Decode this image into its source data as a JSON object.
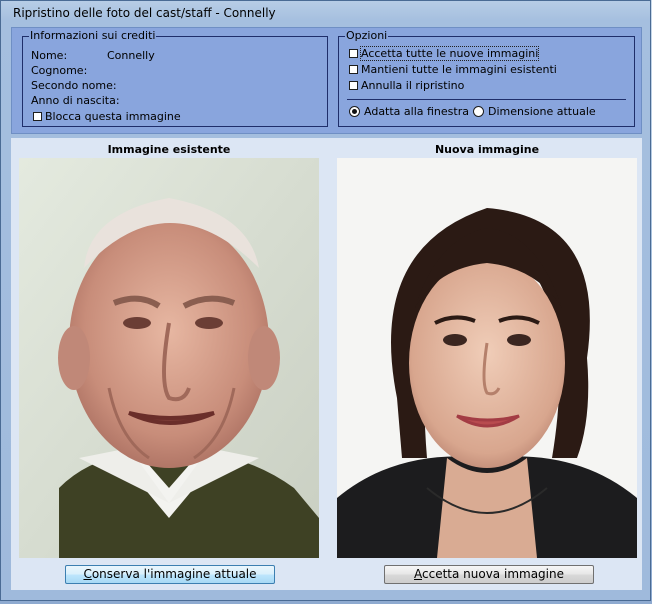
{
  "window": {
    "title": "Ripristino delle foto del cast/staff - Connelly"
  },
  "credits": {
    "legend": "Informazioni sui crediti",
    "fields": [
      {
        "label": "Nome:",
        "value": "Connelly"
      },
      {
        "label": "Cognome:",
        "value": ""
      },
      {
        "label": "Secondo nome:",
        "value": ""
      },
      {
        "label": "Anno di nascita:",
        "value": ""
      }
    ],
    "lock_label": "Blocca questa immagine",
    "lock_checked": false
  },
  "options": {
    "legend": "Opzioni",
    "checkboxes": [
      {
        "label": "Accetta tutte le nuove immagini",
        "checked": false
      },
      {
        "label": "Mantieni tutte le immagini esistenti",
        "checked": false
      },
      {
        "label": "Annulla il ripristino",
        "checked": false
      }
    ],
    "radios": [
      {
        "label": "Adatta alla finestra",
        "selected": true
      },
      {
        "label": "Dimensione attuale",
        "selected": false
      }
    ]
  },
  "existing": {
    "title": "Immagine esistente",
    "button_pre": "C",
    "button_rest": "onserva l'immagine attuale"
  },
  "new": {
    "title": "Nuova immagine",
    "button_pre": "A",
    "button_rest": "ccetta nuova immagine"
  }
}
